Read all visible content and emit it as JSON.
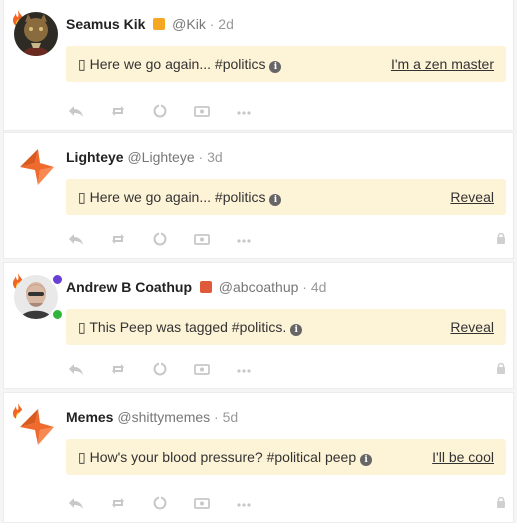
{
  "posts": [
    {
      "name": "Seamus Kik",
      "brand": "orange-square-icon",
      "brand_color": "#f5a623",
      "handle": "@Kik",
      "sep": "·",
      "age": "2d",
      "box": "▯",
      "notice_text": "Here we go again... #politics",
      "reveal": "I'm a zen master",
      "avatar": "cat-portrait-avatar",
      "locked": false
    },
    {
      "name": "Lighteye",
      "handle": "@Lighteye",
      "sep": "·",
      "age": "3d",
      "box": "▯",
      "notice_text": "Here we go again... #politics",
      "reveal": "Reveal",
      "avatar": "orange-star-logo-avatar",
      "locked": true
    },
    {
      "name": "Andrew B Coathup",
      "brand": "red-shield-icon",
      "brand_color": "#e05a3a",
      "handle": "@abcoathup",
      "sep": "·",
      "age": "4d",
      "box": "▯",
      "notice_text": "This Peep was tagged #politics.",
      "reveal": "Reveal",
      "avatar": "bald-man-avatar",
      "locked": true
    },
    {
      "name": "Memes",
      "handle": "@shittymemes",
      "sep": "·",
      "age": "5d",
      "box": "▯",
      "notice_text": "How's your blood pressure? #political peep",
      "reveal": "I'll be cool",
      "avatar": "orange-star-logo-avatar",
      "locked": true
    }
  ],
  "colors": {
    "notice_bg": "#fdf3d6",
    "fire": "#f26522",
    "star": "#ef6a2b",
    "icon_gray": "#c8c8c8"
  },
  "action_icons": [
    "reply-icon",
    "reshare-icon",
    "quote-icon",
    "tip-icon",
    "more-icon"
  ]
}
